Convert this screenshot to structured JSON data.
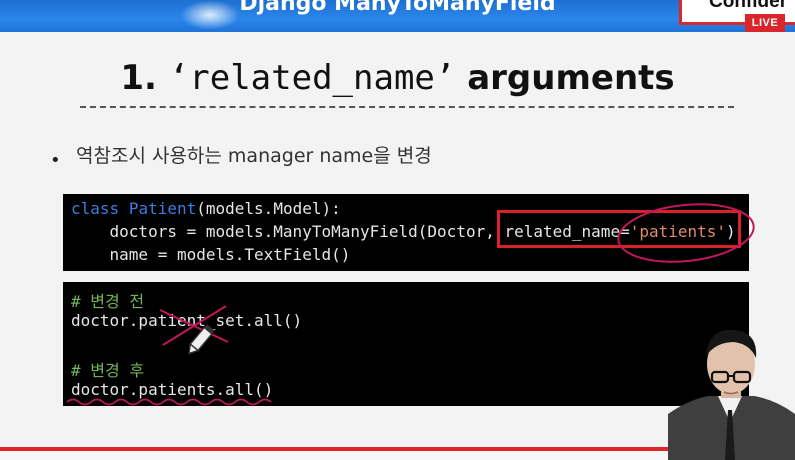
{
  "banner": {
    "title": "Django ManyToManyField",
    "badge": "Confider",
    "live": "LIVE"
  },
  "slide": {
    "number": "1.",
    "arg": "‘related_name’",
    "suffix": "arguments",
    "bullet": "역참조시 사용하는 manager name을 변경"
  },
  "code1": {
    "l1_kw": "class",
    "l1_cls": "Patient",
    "l1_rest": "(models.Model):",
    "l2_a": "    doctors = models.ManyToManyField(Doctor, related_name=",
    "l2_str": "'patients'",
    "l2_b": ")",
    "l3": "    name = models.TextField()"
  },
  "code2": {
    "c1": "# 변경 전",
    "l1": "doctor.patient_set.all()",
    "c2": "# 변경 후",
    "l2": "doctor.patients.all()"
  },
  "colors": {
    "accent": "#d9202b",
    "banner": "#2b86ea",
    "keyword": "#3b7de2",
    "string": "#e08a6a",
    "comment": "#74b35d"
  }
}
